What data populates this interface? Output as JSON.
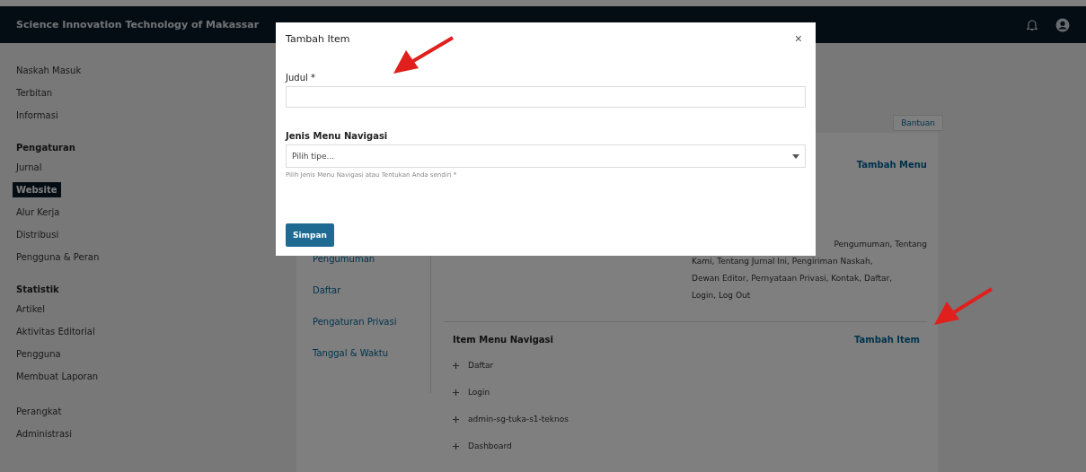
{
  "header": {
    "title": "Science Innovation Technology of Makassar"
  },
  "sidebar": {
    "groups": [
      {
        "items": [
          {
            "label": "Naskah Masuk",
            "selected": false
          },
          {
            "label": "Terbitan",
            "selected": false
          },
          {
            "label": "Informasi",
            "selected": false
          }
        ]
      },
      {
        "heading": "Pengaturan",
        "items": [
          {
            "label": "Jurnal",
            "selected": false
          },
          {
            "label": "Website",
            "selected": true
          },
          {
            "label": "Alur Kerja",
            "selected": false
          },
          {
            "label": "Distribusi",
            "selected": false
          },
          {
            "label": "Pengguna & Peran",
            "selected": false
          }
        ]
      },
      {
        "heading": "Statistik",
        "items": [
          {
            "label": "Artikel",
            "selected": false
          },
          {
            "label": "Aktivitas Editorial",
            "selected": false
          },
          {
            "label": "Pengguna",
            "selected": false
          },
          {
            "label": "Membuat Laporan",
            "selected": false
          }
        ]
      },
      {
        "items": [
          {
            "label": "Perangkat",
            "selected": false
          },
          {
            "label": "Administrasi",
            "selected": false
          }
        ]
      }
    ]
  },
  "help_button": "Bantuan",
  "vertical_tabs": [
    {
      "label": "Pengumuman",
      "selected": false
    },
    {
      "label": "Daftar",
      "selected": false
    },
    {
      "label": "Pengaturan Privasi",
      "selected": false
    },
    {
      "label": "Tanggal & Waktu",
      "selected": false
    }
  ],
  "menus_section": {
    "add_link": "Tambah Menu",
    "description_lines": [
      "Pengumuman, Tentang",
      "Kami, Tentang Jurnal Ini, Pengiriman Naskah,",
      "Dewan Editor, Pernyataan Privasi, Kontak, Daftar,",
      "Login, Log Out"
    ]
  },
  "items_section": {
    "heading": "Item Menu Navigasi",
    "add_link": "Tambah Item",
    "items": [
      "Daftar",
      "Login",
      "admin-sg-tuka-s1-teknos",
      "Dashboard"
    ]
  },
  "modal": {
    "title": "Tambah Item",
    "close": "×",
    "fields": [
      {
        "kind": "text",
        "label": "Judul *"
      },
      {
        "kind": "select",
        "label": "Jenis Menu Navigasi",
        "placeholder": "Pilih tipe...",
        "hint": "Pilih Jenis Menu Navigasi atau Tentukan Anda sendiri *"
      }
    ],
    "submit": "Simpan"
  }
}
